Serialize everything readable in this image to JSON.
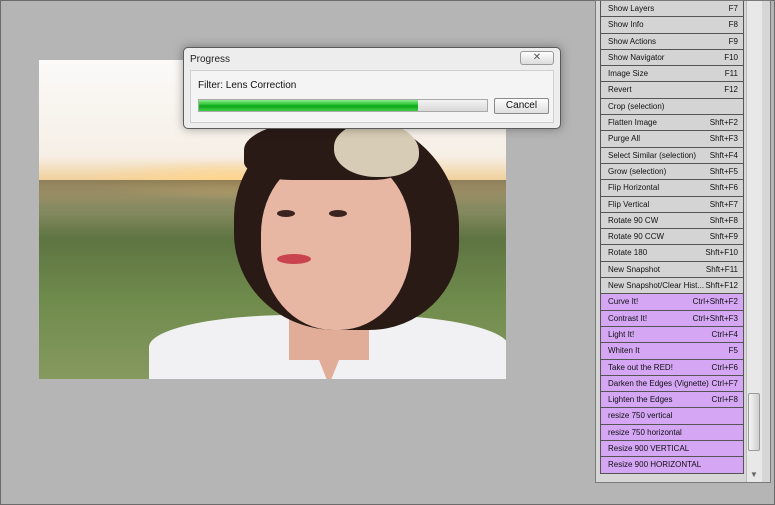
{
  "dialog": {
    "title": "Progress",
    "close_glyph": "✕",
    "message": "Filter: Lens Correction",
    "progress": 0.76,
    "cancel_label": "Cancel"
  },
  "actions": [
    {
      "label": "Show Layers",
      "shortcut": "F7",
      "color": "gray"
    },
    {
      "label": "Show Info",
      "shortcut": "F8",
      "color": "gray"
    },
    {
      "label": "Show Actions",
      "shortcut": "F9",
      "color": "gray"
    },
    {
      "label": "Show Navigator",
      "shortcut": "F10",
      "color": "gray"
    },
    {
      "label": "Image Size",
      "shortcut": "F11",
      "color": "gray"
    },
    {
      "label": "Revert",
      "shortcut": "F12",
      "color": "gray"
    },
    {
      "label": "Crop (selection)",
      "shortcut": "",
      "color": "gray"
    },
    {
      "label": "Flatten Image",
      "shortcut": "Shft+F2",
      "color": "gray"
    },
    {
      "label": "Purge All",
      "shortcut": "Shft+F3",
      "color": "gray"
    },
    {
      "label": "Select Similar (selection)",
      "shortcut": "Shft+F4",
      "color": "gray"
    },
    {
      "label": "Grow (selection)",
      "shortcut": "Shft+F5",
      "color": "gray"
    },
    {
      "label": "Flip Horizontal",
      "shortcut": "Shft+F6",
      "color": "gray"
    },
    {
      "label": "Flip Vertical",
      "shortcut": "Shft+F7",
      "color": "gray"
    },
    {
      "label": "Rotate 90 CW",
      "shortcut": "Shft+F8",
      "color": "gray"
    },
    {
      "label": "Rotate 90 CCW",
      "shortcut": "Shft+F9",
      "color": "gray"
    },
    {
      "label": "Rotate 180",
      "shortcut": "Shft+F10",
      "color": "gray"
    },
    {
      "label": "New Snapshot",
      "shortcut": "Shft+F11",
      "color": "gray"
    },
    {
      "label": "New Snapshot/Clear Hist...",
      "shortcut": "Shft+F12",
      "color": "gray"
    },
    {
      "label": "Curve It!",
      "shortcut": "Ctrl+Shft+F2",
      "color": "purple"
    },
    {
      "label": "Contrast It!",
      "shortcut": "Ctrl+Shft+F3",
      "color": "purple"
    },
    {
      "label": "Light It!",
      "shortcut": "Ctrl+F4",
      "color": "purple"
    },
    {
      "label": "Whiten It",
      "shortcut": "F5",
      "color": "purple"
    },
    {
      "label": "Take out the RED!",
      "shortcut": "Ctrl+F6",
      "color": "purple"
    },
    {
      "label": "Darken the Edges (Vignette)",
      "shortcut": "Ctrl+F7",
      "color": "purple"
    },
    {
      "label": "Lighten the Edges",
      "shortcut": "Ctrl+F8",
      "color": "purple"
    },
    {
      "label": "resize 750 vertical",
      "shortcut": "",
      "color": "purple"
    },
    {
      "label": "resize 750 horizontal",
      "shortcut": "",
      "color": "purple"
    },
    {
      "label": "Resize 900 VERTICAL",
      "shortcut": "",
      "color": "purple"
    },
    {
      "label": "Resize 900 HORIZONTAL",
      "shortcut": "",
      "color": "purple"
    }
  ],
  "colors": {
    "canvas_bg": "#b5b5b5",
    "action_gray": "#d4d4d4",
    "action_purple": "#d4a6f4",
    "progress_green": "#1fbf2a"
  }
}
